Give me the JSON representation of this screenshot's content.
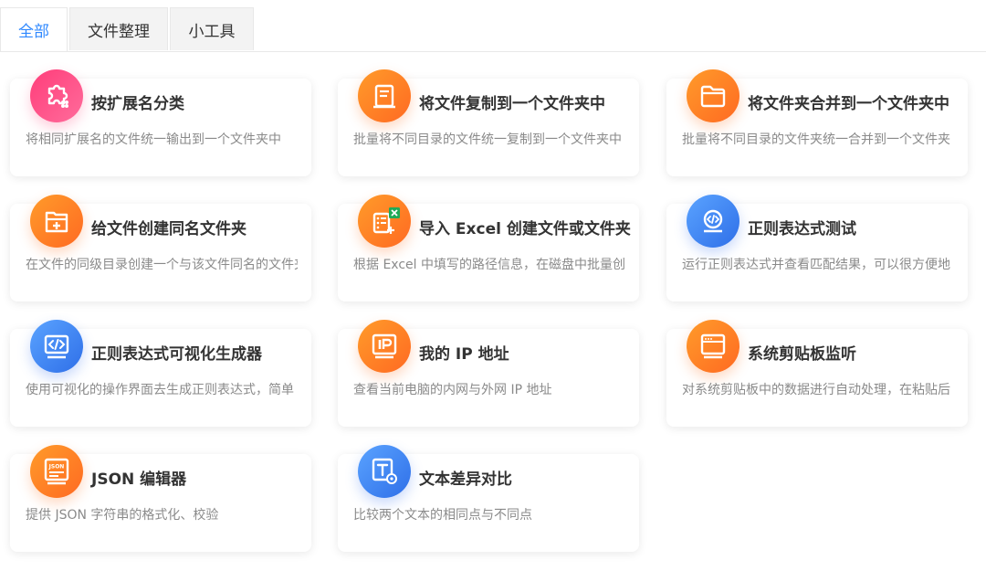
{
  "tabs": [
    "全部",
    "文件整理",
    "小工具"
  ],
  "cards": [
    {
      "title": "按扩展名分类",
      "desc": "将相同扩展名的文件统一输出到一个文件夹中",
      "icon": "puzzle-icon",
      "color": "pink"
    },
    {
      "title": "将文件复制到一个文件夹中",
      "desc": "批量将不同目录的文件统一复制到一个文件夹中",
      "icon": "copy-file-icon",
      "color": "orange"
    },
    {
      "title": "将文件夹合并到一个文件夹中",
      "desc": "批量将不同目录的文件夹统一合并到一个文件夹",
      "icon": "folder-icon",
      "color": "orange"
    },
    {
      "title": "给文件创建同名文件夹",
      "desc": "在文件的同级目录创建一个与该文件同名的文件夹",
      "icon": "folder-add-icon",
      "color": "orange"
    },
    {
      "title": "导入 Excel 创建文件或文件夹",
      "desc": "根据 Excel 中填写的路径信息，在磁盘中批量创建",
      "icon": "excel-icon",
      "color": "orange"
    },
    {
      "title": "正则表达式测试",
      "desc": "运行正则表达式并查看匹配结果，可以很方便地",
      "icon": "regex-test-icon",
      "color": "blue"
    },
    {
      "title": "正则表达式可视化生成器",
      "desc": "使用可视化的操作界面去生成正则表达式，简单",
      "icon": "code-icon",
      "color": "blue"
    },
    {
      "title": "我的 IP 地址",
      "desc": "查看当前电脑的内网与外网 IP 地址",
      "icon": "ip-icon",
      "color": "orange"
    },
    {
      "title": "系统剪贴板监听",
      "desc": "对系统剪贴板中的数据进行自动处理，在粘贴后",
      "icon": "window-icon",
      "color": "orange"
    },
    {
      "title": "JSON 编辑器",
      "desc": "提供 JSON 字符串的格式化、校验",
      "icon": "json-icon",
      "color": "orange"
    },
    {
      "title": "文本差异对比",
      "desc": "比较两个文本的相同点与不同点",
      "icon": "text-compare-icon",
      "color": "blue"
    }
  ],
  "colors": {
    "accent": "#2f88ff",
    "pink": "#ff4d86",
    "orange": "#ff8a26",
    "blue": "#3d82f2"
  }
}
